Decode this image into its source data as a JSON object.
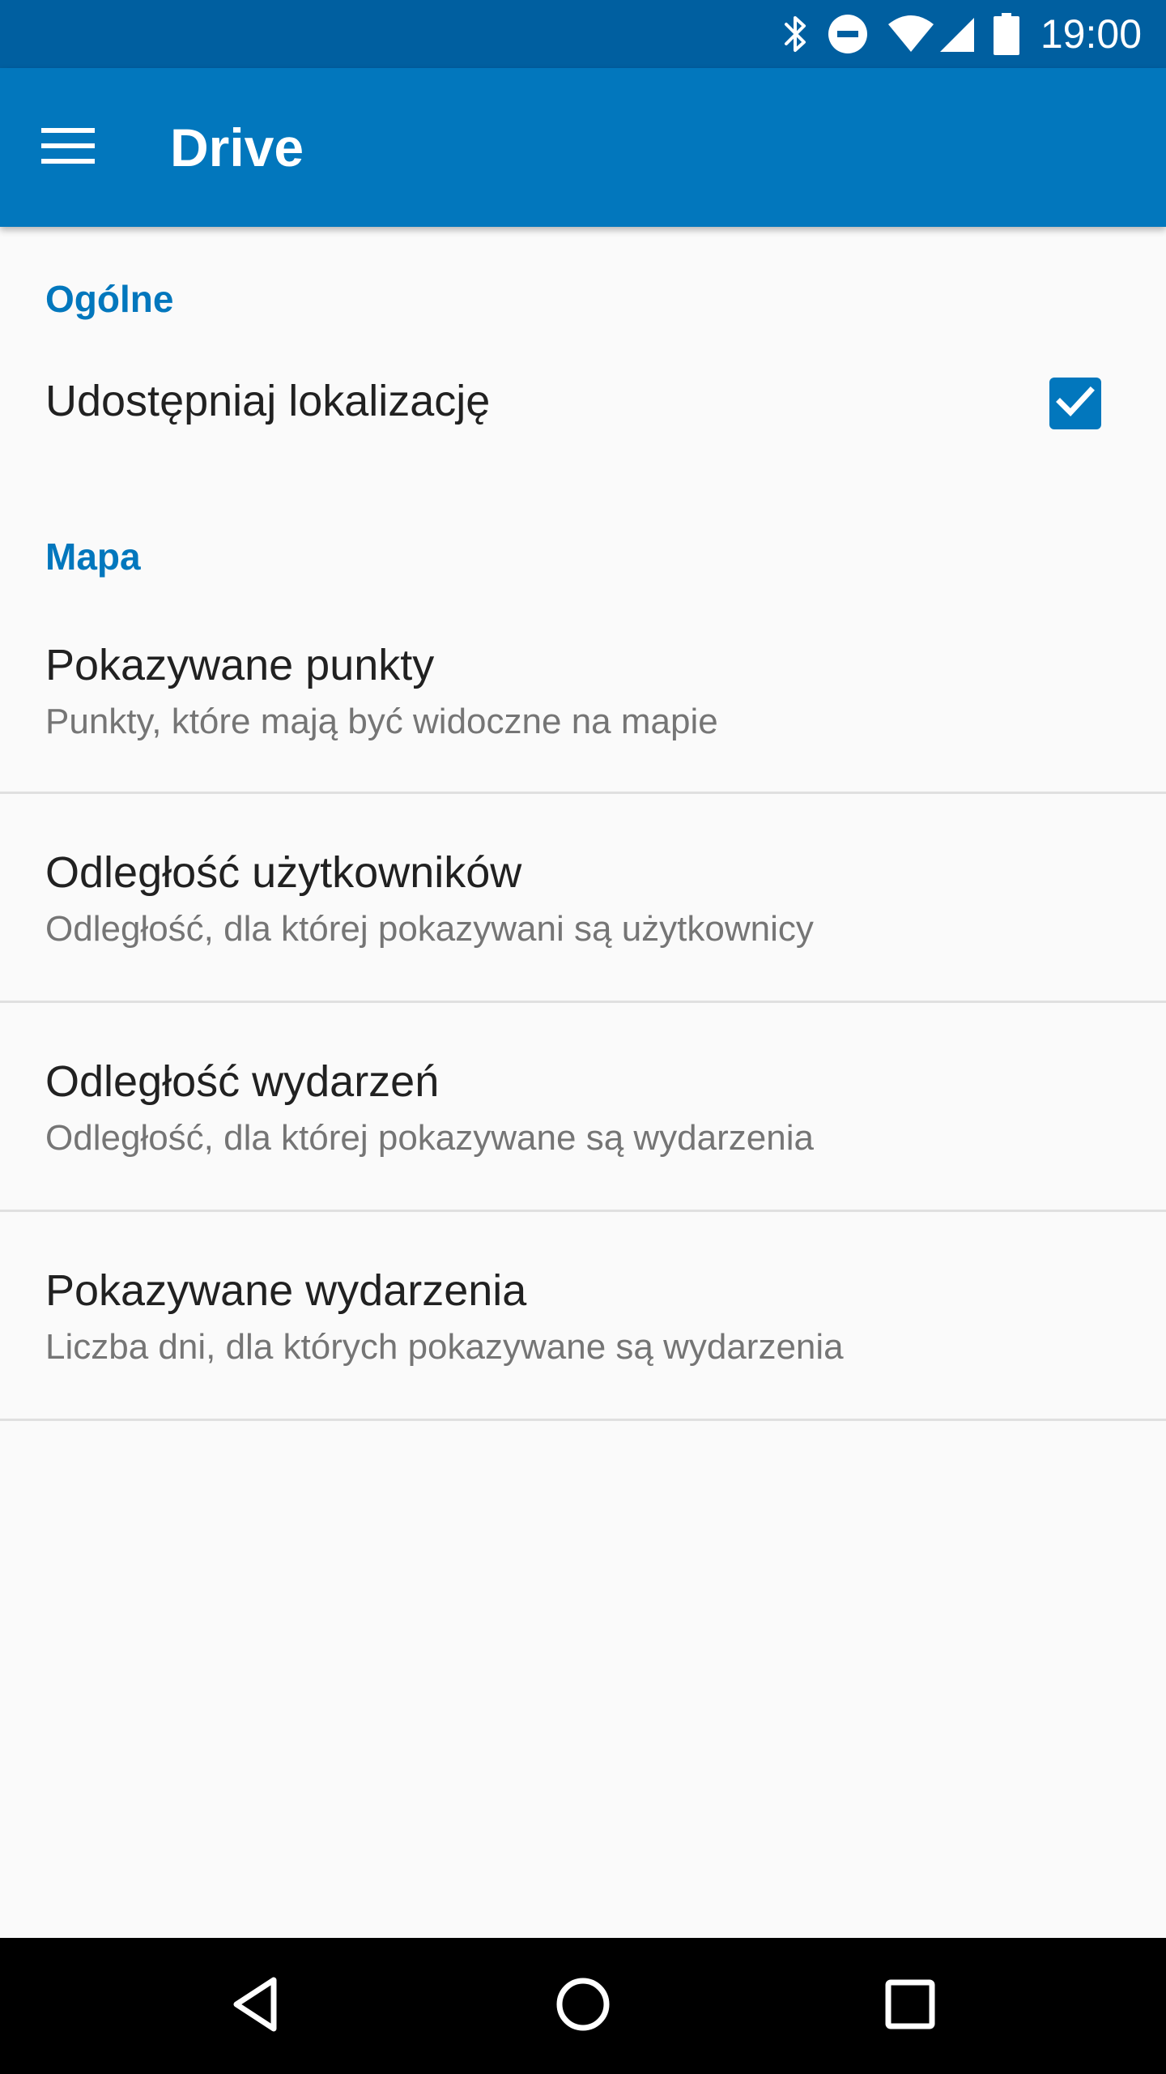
{
  "status_bar": {
    "time": "19:00",
    "icons": [
      "bluetooth-icon",
      "do-not-disturb-icon",
      "wifi-icon",
      "cell-signal-icon",
      "battery-icon"
    ]
  },
  "app_bar": {
    "title": "Drive",
    "menu_icon": "hamburger-menu-icon",
    "background": "#0277bd"
  },
  "sections": {
    "general": {
      "header": "Ogólne",
      "share_location": {
        "title": "Udostępniaj lokalizację",
        "checked": true
      }
    },
    "map": {
      "header": "Mapa",
      "items": [
        {
          "title": "Pokazywane punkty",
          "summary": "Punkty, które mają być widoczne na mapie"
        },
        {
          "title": "Odległość użytkowników",
          "summary": "Odległość, dla której pokazywani są użytkownicy"
        },
        {
          "title": "Odległość wydarzeń",
          "summary": "Odległość, dla której pokazywane są wydarzenia"
        },
        {
          "title": "Pokazywane wydarzenia",
          "summary": "Liczba dni, dla których pokazywane są wydarzenia"
        }
      ]
    }
  },
  "colors": {
    "accent": "#0277bd",
    "status_bar": "#005fa0",
    "background": "#fafafa"
  },
  "nav_bar": {
    "icons": [
      "back-icon",
      "home-icon",
      "recents-icon"
    ]
  }
}
